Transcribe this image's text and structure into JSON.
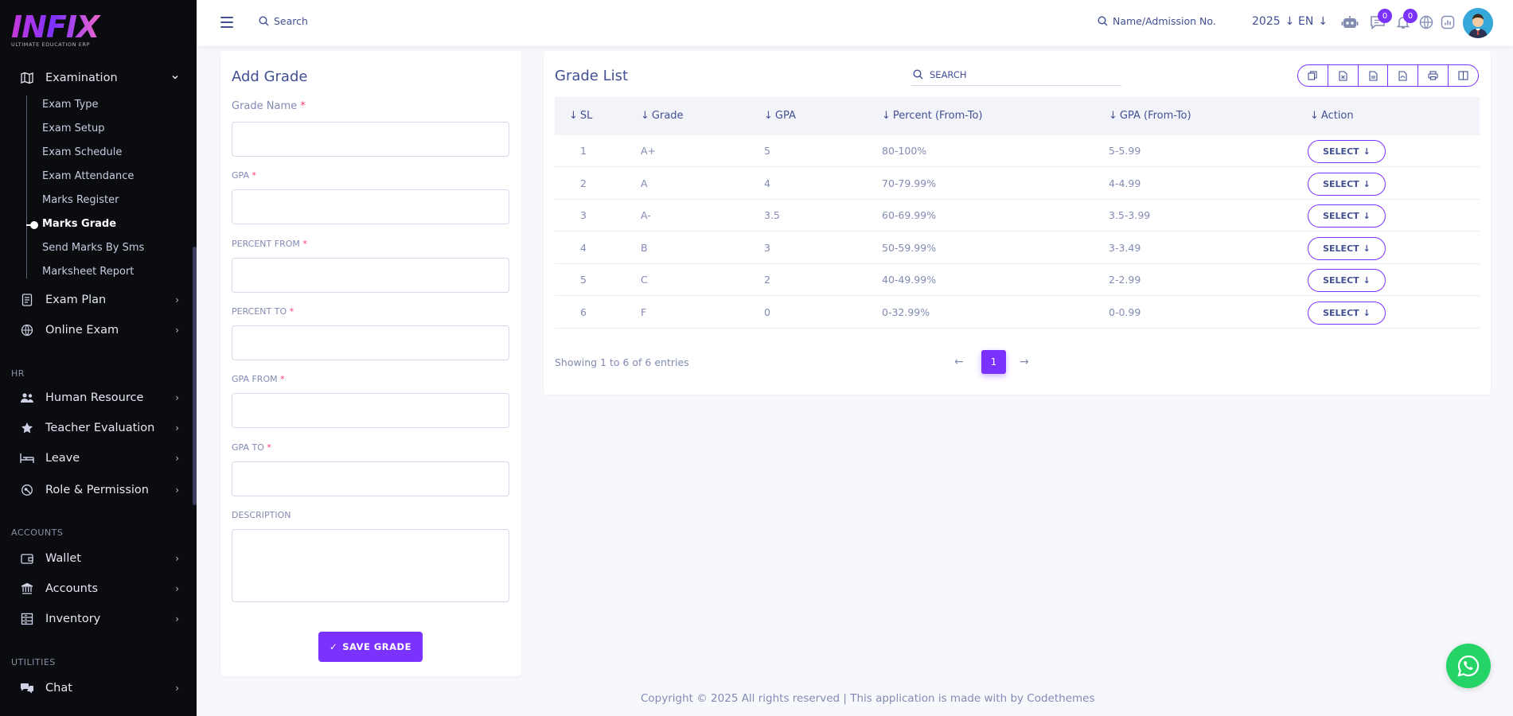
{
  "brand": {
    "logo_text": "INFIX",
    "tagline": "ULTIMATE EDUCATION ERP"
  },
  "header": {
    "search_label": "Search",
    "student_search_label": "Name/Admission No.",
    "year": "2025",
    "language": "EN",
    "messages_count": "0",
    "notifications_count": "0"
  },
  "sidebar": {
    "examination": {
      "label": "Examination",
      "items": [
        {
          "label": "Exam Type"
        },
        {
          "label": "Exam Setup"
        },
        {
          "label": "Exam Schedule"
        },
        {
          "label": "Exam Attendance"
        },
        {
          "label": "Marks Register"
        },
        {
          "label": "Marks Grade"
        },
        {
          "label": "Send Marks By Sms"
        },
        {
          "label": "Marksheet Report"
        }
      ]
    },
    "exam_plan": "Exam Plan",
    "online_exam": "Online Exam",
    "section_hr": "HR",
    "human_resource": "Human Resource",
    "teacher_evaluation": "Teacher Evaluation",
    "leave": "Leave",
    "role_permission": "Role & Permission",
    "section_accounts": "ACCOUNTS",
    "wallet": "Wallet",
    "accounts": "Accounts",
    "inventory": "Inventory",
    "section_utilities": "UTILITIES",
    "chat": "Chat"
  },
  "add_grade": {
    "title": "Add Grade",
    "grade_name": "Grade Name",
    "gpa": "GPA",
    "percent_from": "PERCENT FROM",
    "percent_to": "PERCENT TO",
    "gpa_from": "GPA FROM",
    "gpa_to": "GPA TO",
    "description": "DESCRIPTION",
    "required_mark": "*",
    "save_label": "SAVE GRADE"
  },
  "grade_list": {
    "title": "Grade List",
    "search_label": "SEARCH",
    "columns": [
      "SL",
      "Grade",
      "GPA",
      "Percent (From-To)",
      "GPA (From-To)",
      "Action"
    ],
    "rows": [
      {
        "sl": "1",
        "grade": "A+",
        "gpa": "5",
        "percent": "80-100%",
        "gpa_range": "5-5.99",
        "action": "SELECT"
      },
      {
        "sl": "2",
        "grade": "A",
        "gpa": "4",
        "percent": "70-79.99%",
        "gpa_range": "4-4.99",
        "action": "SELECT"
      },
      {
        "sl": "3",
        "grade": "A-",
        "gpa": "3.5",
        "percent": "60-69.99%",
        "gpa_range": "3.5-3.99",
        "action": "SELECT"
      },
      {
        "sl": "4",
        "grade": "B",
        "gpa": "3",
        "percent": "50-59.99%",
        "gpa_range": "3-3.49",
        "action": "SELECT"
      },
      {
        "sl": "5",
        "grade": "C",
        "gpa": "2",
        "percent": "40-49.99%",
        "gpa_range": "2-2.99",
        "action": "SELECT"
      },
      {
        "sl": "6",
        "grade": "F",
        "gpa": "0",
        "percent": "0-32.99%",
        "gpa_range": "0-0.99",
        "action": "SELECT"
      }
    ],
    "entries_text": "Showing 1 to 6 of 6 entries",
    "current_page": "1"
  },
  "footer": {
    "text": "Copyright © 2025 All rights reserved | This application is made with by Codethemes"
  },
  "colors": {
    "accent": "#7c32ff",
    "primary_text": "#415094",
    "muted_text": "#828bb2",
    "sidebar_bg": "#0b0c10",
    "whatsapp": "#25d366"
  }
}
